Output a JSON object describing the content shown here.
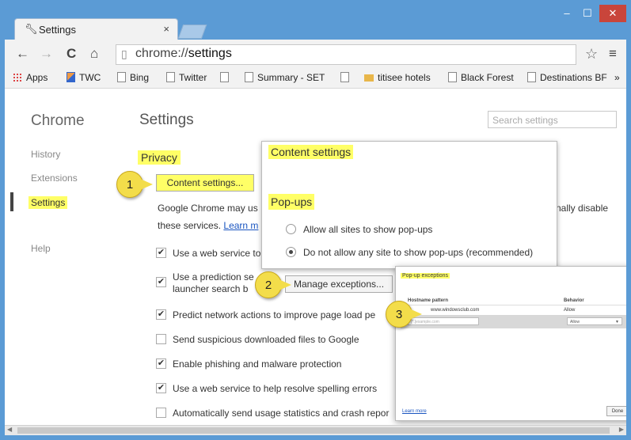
{
  "window": {
    "minimize": "–",
    "maximize": "☐",
    "close": "✕"
  },
  "tab": {
    "icon": "wrench-icon",
    "title": "Settings",
    "close": "×"
  },
  "toolbar": {
    "back": "←",
    "forward": "→",
    "reload": "C",
    "home": "⌂",
    "url_scheme": "chrome://",
    "url_path": "settings",
    "star": "☆",
    "menu": "≡"
  },
  "bookmarks": [
    "Apps",
    "TWC",
    "Bing",
    "Twitter",
    "Summary - SET",
    "titisee hotels",
    "Black Forest",
    "Destinations BF",
    "»"
  ],
  "sidebar": {
    "title": "Chrome",
    "items": [
      "History",
      "Extensions",
      "Settings",
      "Help"
    ]
  },
  "main": {
    "title": "Settings",
    "search_placeholder": "Search settings",
    "privacy": "Privacy",
    "content_settings_button": "Content settings...",
    "desc_line1": "Google Chrome may us",
    "desc_line1_end": "nally disable",
    "desc_line2": "these services.",
    "learn_more": "Learn m",
    "options": [
      {
        "label": "Use a web service to",
        "checked": true
      },
      {
        "label": "Use a prediction se",
        "label2": "launcher search b",
        "checked": true
      },
      {
        "label": "Predict network actions to improve page load pe",
        "checked": true
      },
      {
        "label": "Send suspicious downloaded files to Google",
        "checked": false
      },
      {
        "label": "Enable phishing and malware protection",
        "checked": true
      },
      {
        "label": "Use a web service to help resolve spelling errors",
        "checked": true
      },
      {
        "label": "Automatically send usage statistics and crash repor",
        "checked": false
      }
    ]
  },
  "content_settings": {
    "title": "Content settings",
    "popups": "Pop-ups",
    "allow": "Allow all sites to show pop-ups",
    "block": "Do not allow any site to show pop-ups (recommended)",
    "manage": "Manage exceptions..."
  },
  "popup_exceptions": {
    "title": "Pop-up exceptions",
    "close": "×",
    "col_host": "Hostname pattern",
    "col_behavior": "Behavior",
    "row1_host": "www.windowsclub.com",
    "row1_behavior": "Allow",
    "input_placeholder": "[*.]example.com",
    "select_value": "Allow",
    "learn_more": "Learn more",
    "done": "Done"
  },
  "callouts": [
    "1",
    "2",
    "3"
  ]
}
